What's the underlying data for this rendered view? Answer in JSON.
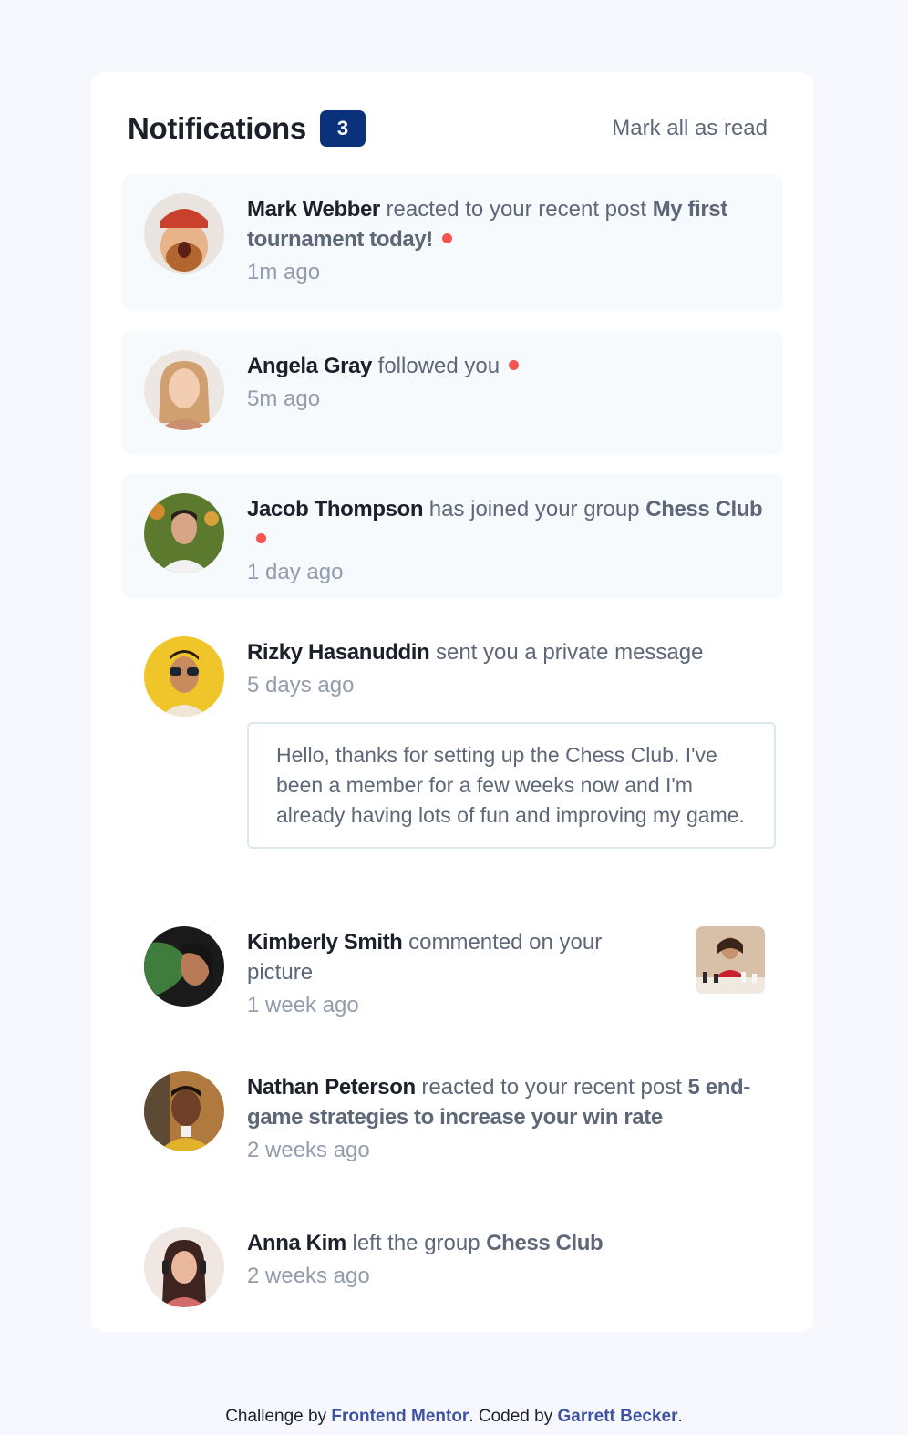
{
  "header": {
    "title": "Notifications",
    "unread_count": "3",
    "mark_all_label": "Mark all as read"
  },
  "notifications": [
    {
      "name": "Mark Webber",
      "action": " reacted to your recent post ",
      "target": "My first tournament today!",
      "time": "1m ago",
      "unread": true
    },
    {
      "name": "Angela Gray",
      "action": " followed you",
      "target": "",
      "time": "5m ago",
      "unread": true
    },
    {
      "name": "Jacob Thompson",
      "action": " has joined your group ",
      "target": "Chess Club",
      "time": "1 day ago",
      "unread": true
    },
    {
      "name": "Rizky Hasanuddin",
      "action": " sent you a private message",
      "target": "",
      "time": "5 days ago",
      "unread": false,
      "message": "Hello, thanks for setting up the Chess Club. I've been a member for a few weeks now and I'm already having lots of fun and improving my game."
    },
    {
      "name": "Kimberly Smith",
      "action": " commented on your picture",
      "target": "",
      "time": "1 week ago",
      "unread": false
    },
    {
      "name": "Nathan Peterson",
      "action": " reacted to your recent post ",
      "target": "5 end-game strategies to increase your win rate",
      "time": "2 weeks ago",
      "unread": false
    },
    {
      "name": "Anna Kim",
      "action": " left the group ",
      "target": "Chess Club",
      "time": "2 weeks ago",
      "unread": false
    }
  ],
  "footer": {
    "prefix": "Challenge by ",
    "link1": "Frontend Mentor",
    "middle": ". Coded by ",
    "link2": "Garrett Becker",
    "suffix": "."
  },
  "colors": {
    "unread_bg": "#f7fafd",
    "badge_bg": "#0a327b",
    "dot": "#f65552",
    "name": "#1c202b",
    "muted": "#939cad",
    "text": "#5e6778",
    "link": "#3e52a3"
  }
}
